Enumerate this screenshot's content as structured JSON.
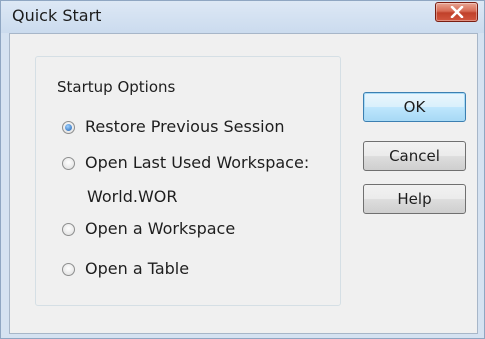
{
  "window": {
    "title": "Quick Start"
  },
  "group": {
    "label": "Startup Options"
  },
  "options": [
    {
      "label": "Restore Previous Session",
      "checked": true
    },
    {
      "label": "Open Last Used Workspace:",
      "checked": false
    },
    {
      "label": "Open a Workspace",
      "checked": false
    },
    {
      "label": "Open a Table",
      "checked": false
    }
  ],
  "last_workspace_name": "World.WOR",
  "buttons": {
    "ok": "OK",
    "cancel": "Cancel",
    "help": "Help"
  },
  "colors": {
    "close_button": "#d2563f",
    "default_button_border": "#3c7fb1",
    "dialog_face": "#f0f0f0"
  }
}
